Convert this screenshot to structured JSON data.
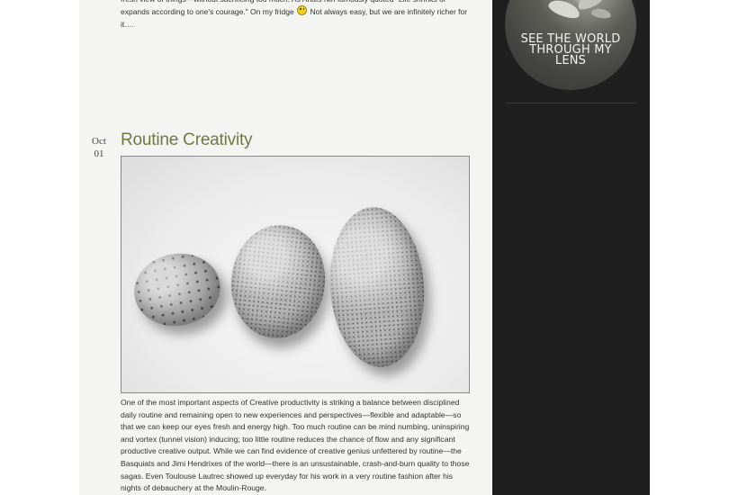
{
  "sidebar": {
    "badge_lines": [
      "SEE THE WORLD",
      "THROUGH MY",
      "LENS"
    ]
  },
  "previous_post": {
    "excerpt_part1": "fresh view of things—without sacrificing too much. As Anaïs Nin famously quoted \"Life shrinks or expands according to one's courage.\" On my fridge",
    "excerpt_part2": "Not always easy, but we are infinitely richer for it….",
    "emoji_icon": "smiley-icon"
  },
  "post": {
    "month": "Oct",
    "day": "01",
    "title": "Routine Creativity",
    "body": "One of the most important aspects of Creative productivity is striking a balance between disciplined daily routine and remaining open to new experiences and perspectives—flexible and adaptable—so that we can keep our eyes fresh and energy high. Too much routine can be mind numbing, uninspiring and vortex (tunnel vision) inducing; too little routine reduces the chance of flow and any significant productive creative output. While we can find evidence of creative genius unfettered by routine—the Basquiats and Jimi Hendrixes of the world—there is an unsustainable, crash-and-burn quality to those sagas. Even Toulouse Lautrec showed up everyday for his work in a very routine fashion after his nights of debauchery at the Moulin-Rouge."
  },
  "colors": {
    "title": "#6f7a42",
    "sidebar": "#1f1f1f",
    "content_bg": "#f4f4f2"
  }
}
